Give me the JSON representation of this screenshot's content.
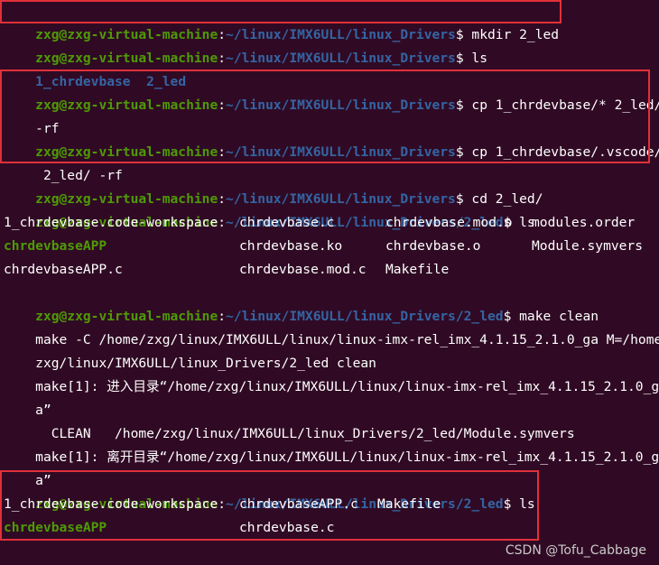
{
  "colors": {
    "background": "#300a24",
    "prompt_user": "#4e9a06",
    "prompt_path": "#3465a4",
    "directory": "#3465a4",
    "executable": "#4e9a06",
    "text": "#ffffff",
    "highlight_box": "#e0303a"
  },
  "prompt": {
    "user_host": "zxg@zxg-virtual-machine",
    "path_drivers": "~/linux/IMX6ULL/linux_Drivers",
    "path_2led": "~/linux/IMX6ULL/linux_Drivers/2_led"
  },
  "lines": {
    "l1_cmd": "$ mkdir 2_led",
    "l2_cmd": "$ ls",
    "l3_dir1": "1_chrdevbase",
    "l3_dir2": "2_led",
    "l4_cmd": "$ cp 1_chrdevbase/* 2_led/",
    "l5_cont": "-rf",
    "l6_cmd": "$ cp 1_chrdevbase/.vscode/",
    "l7_cont": " 2_led/ -rf",
    "l8_cmd": "$ cd 2_led/",
    "l9_cmd": "$ ls",
    "ls1": {
      "r1": [
        "1_chrdevbase.code-workspace",
        "chrdevbase.c",
        "chrdevbase.mod.o",
        "modules.order"
      ],
      "r2": [
        "chrdevbaseAPP",
        "chrdevbase.ko",
        "chrdevbase.o",
        "Module.symvers"
      ],
      "r3": [
        "chrdevbaseAPP.c",
        "chrdevbase.mod.c",
        "Makefile"
      ]
    },
    "l13_cmd": "$ make clean",
    "l14": "make -C /home/zxg/linux/IMX6ULL/linux/linux-imx-rel_imx_4.1.15_2.1.0_ga M=/home/",
    "l15": "zxg/linux/IMX6ULL/linux_Drivers/2_led clean",
    "l16": "make[1]: 进入目录“/home/zxg/linux/IMX6ULL/linux/linux-imx-rel_imx_4.1.15_2.1.0_g",
    "l17": "a”",
    "l18": "  CLEAN   /home/zxg/linux/IMX6ULL/linux_Drivers/2_led/Module.symvers",
    "l19": "make[1]: 离开目录“/home/zxg/linux/IMX6ULL/linux/linux-imx-rel_imx_4.1.15_2.1.0_g",
    "l20": "a”",
    "l21_cmd": "$ ls",
    "ls2": {
      "r1": [
        "1_chrdevbase.code-workspace",
        "chrdevbaseAPP.c",
        "Makefile"
      ],
      "r2": [
        "chrdevbaseAPP",
        "chrdevbase.c"
      ]
    },
    "l24_cmd": "$ "
  },
  "watermark": "CSDN @Tofu_Cabbage"
}
